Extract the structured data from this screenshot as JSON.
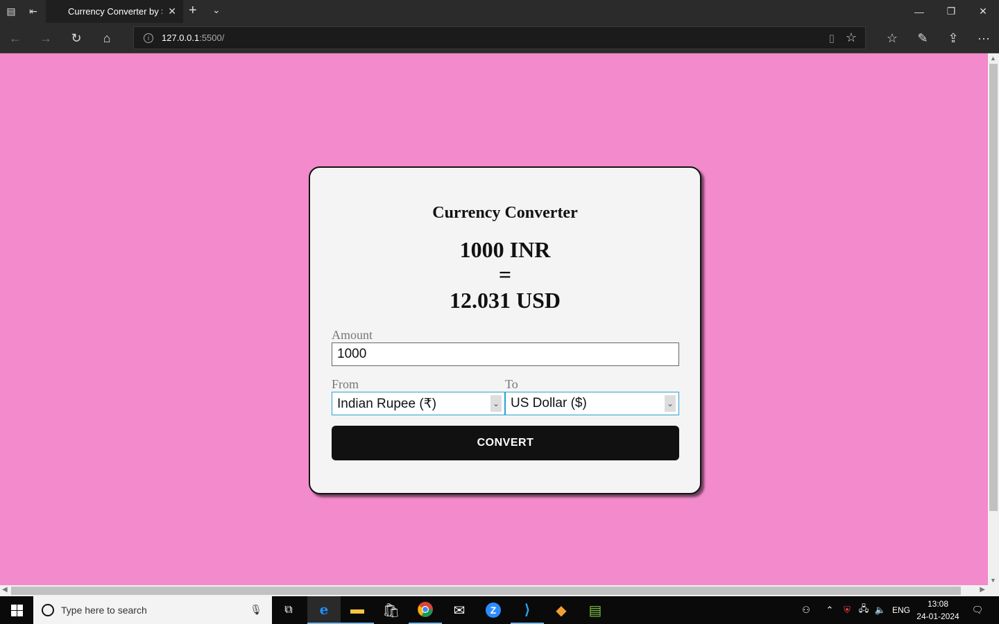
{
  "browser": {
    "tab_title": "Currency Converter by S",
    "url_host": "127.0.0.1",
    "url_path": ":5500/"
  },
  "page": {
    "title": "Currency Converter",
    "result": {
      "from_amount": "1000 INR",
      "equals": "=",
      "to_amount": "12.031 USD"
    },
    "amount_label": "Amount",
    "amount_value": "1000",
    "from_label": "From",
    "from_value": "Indian Rupee (₹)",
    "to_label": "To",
    "to_value": "US Dollar ($)",
    "convert_label": "CONVERT"
  },
  "colors": {
    "page_bg": "#f28acb",
    "card_bg": "#f4f4f4",
    "button_bg": "#111111",
    "select_border": "#29a0d0"
  },
  "taskbar": {
    "search_placeholder": "Type here to search",
    "language": "ENG",
    "time": "13:08",
    "date": "24-01-2024",
    "apps": [
      "task-view",
      "edge",
      "file-explorer",
      "store",
      "chrome",
      "mail",
      "zoom",
      "vscode",
      "git",
      "notepad"
    ]
  }
}
